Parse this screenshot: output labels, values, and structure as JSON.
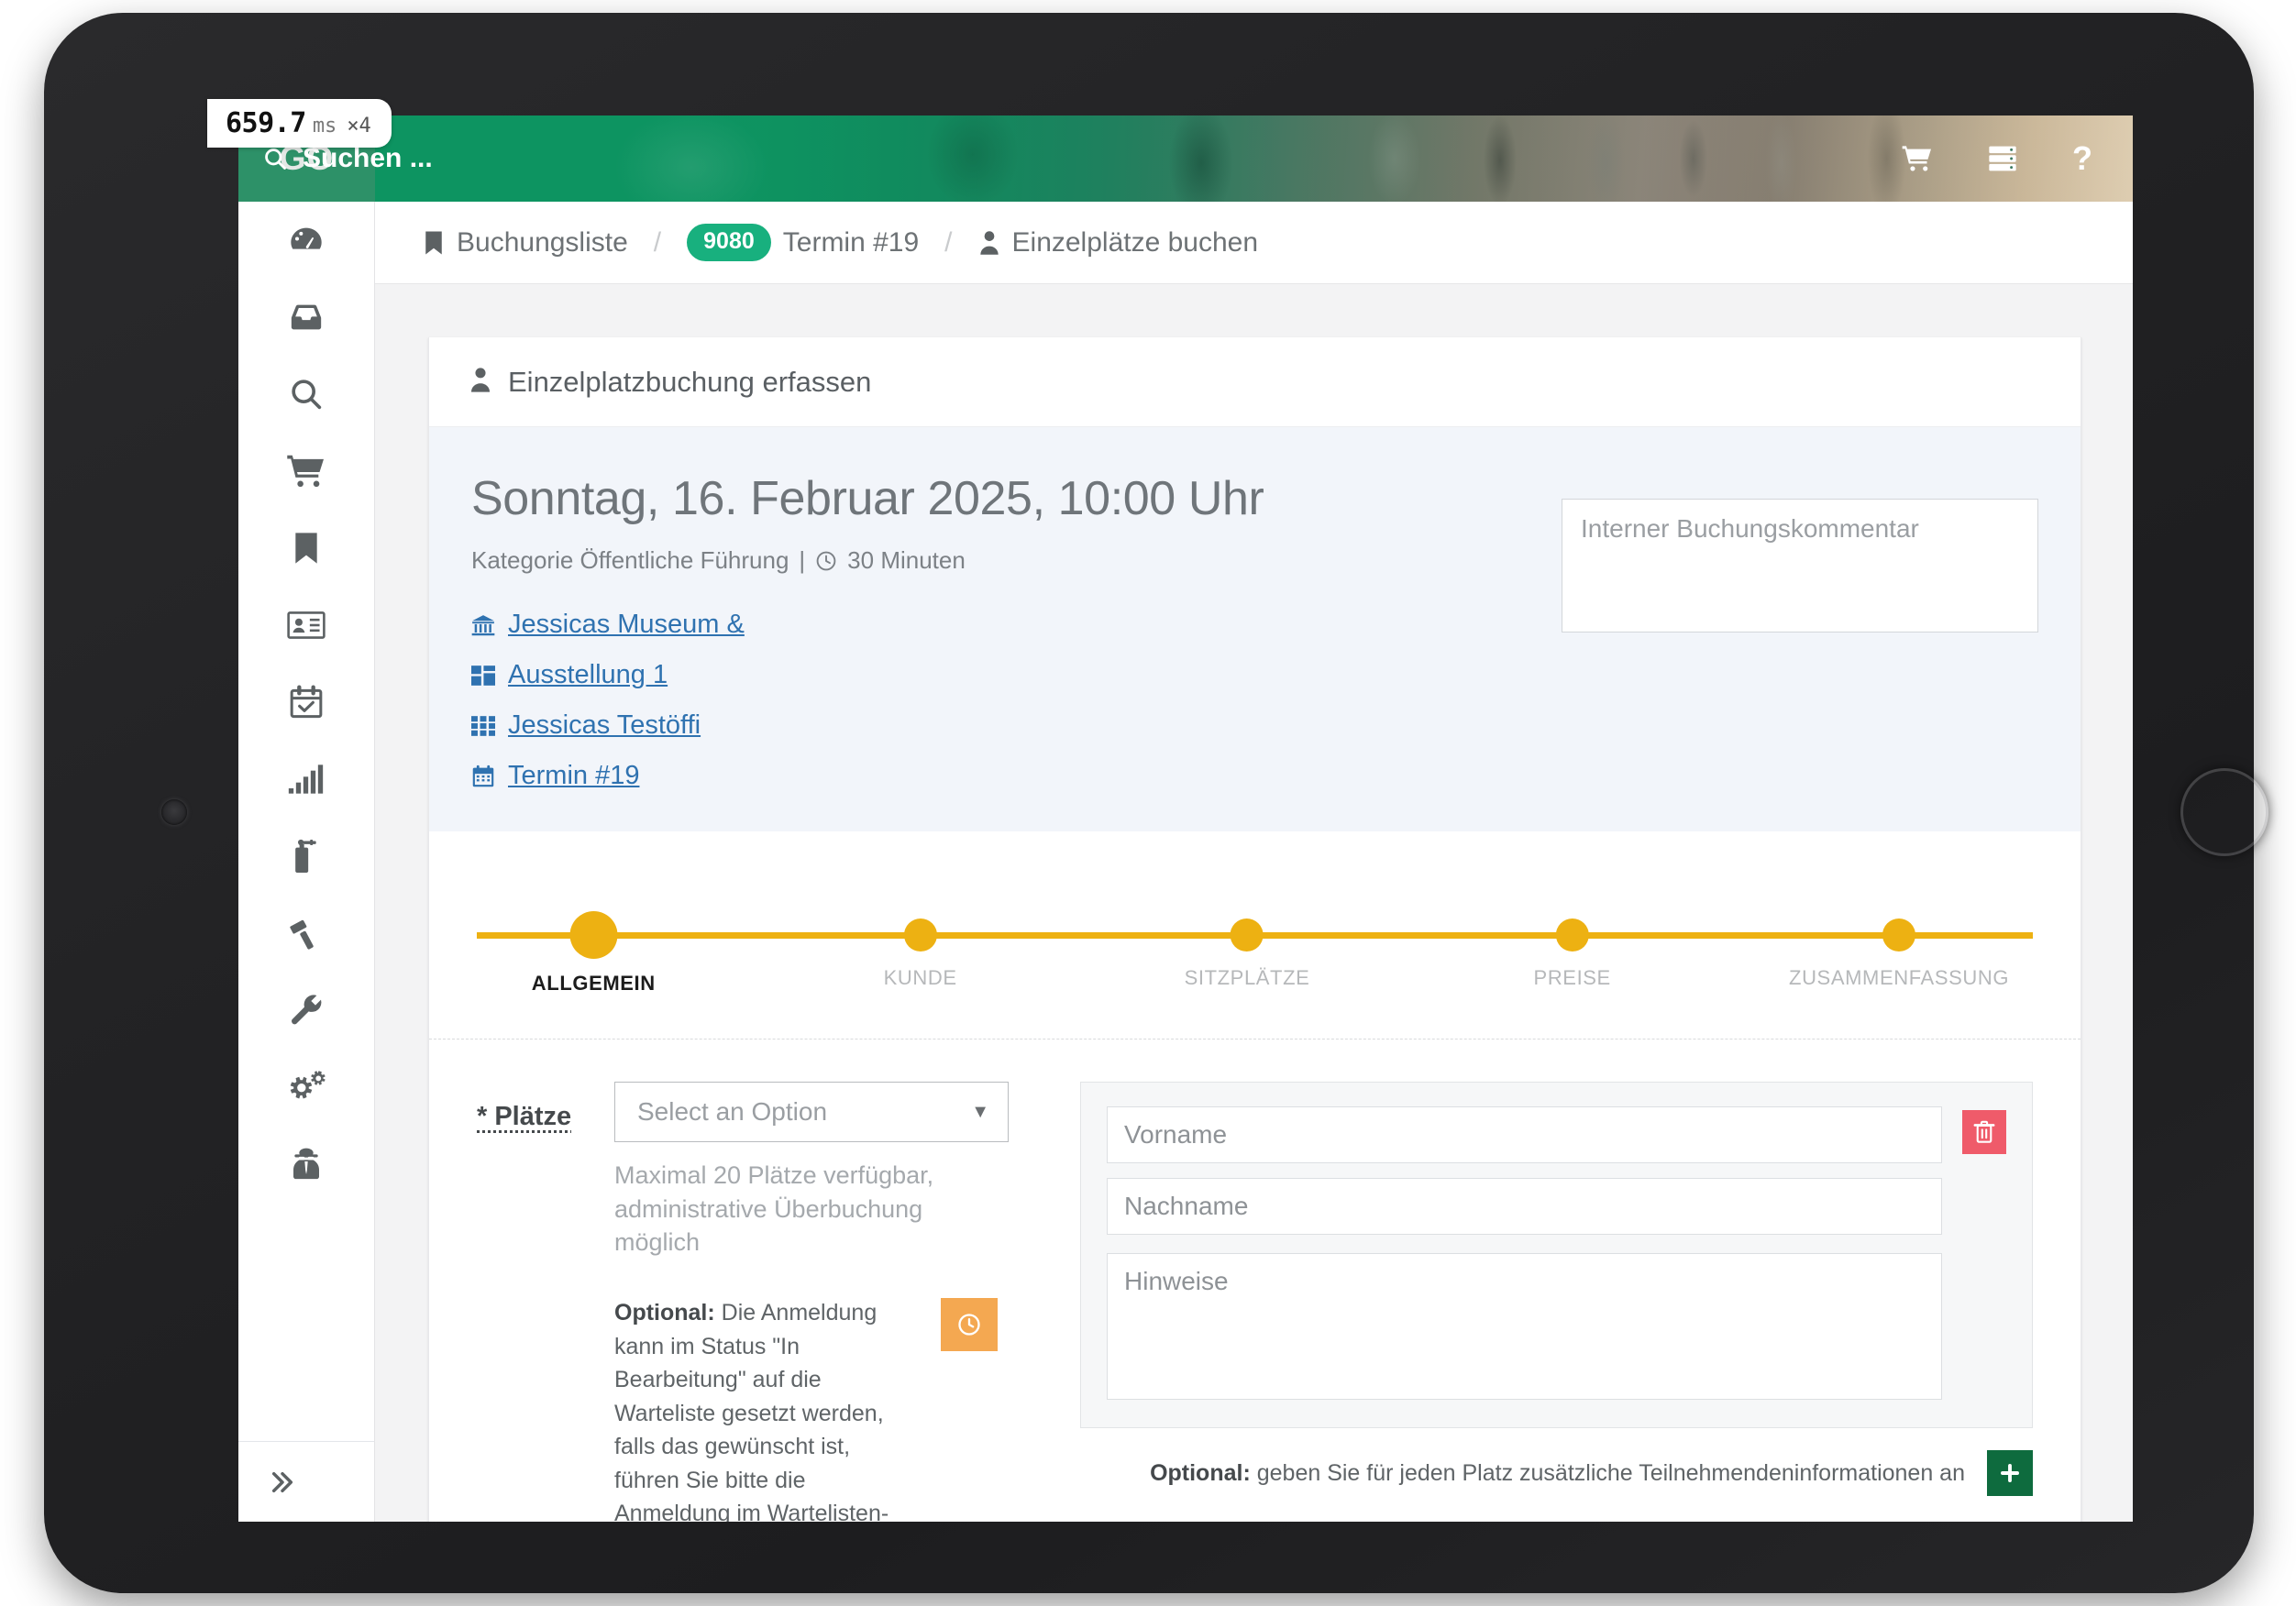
{
  "perf": {
    "value": "659.7",
    "unit": "ms",
    "multiplier": "×4"
  },
  "topbar": {
    "brand": "GO",
    "search_placeholder": "Suchen ...",
    "icons": {
      "search": "search-icon",
      "cart": "shopping-cart-icon",
      "server": "server-icon",
      "help": "?"
    }
  },
  "sidebar": {
    "items": [
      {
        "name": "dashboard",
        "icon": "tachometer-icon"
      },
      {
        "name": "inbox",
        "icon": "inbox-icon"
      },
      {
        "name": "search",
        "icon": "search-icon"
      },
      {
        "name": "shop",
        "icon": "shopping-cart-icon"
      },
      {
        "name": "bookings",
        "icon": "bookmark-icon"
      },
      {
        "name": "contacts",
        "icon": "id-card-icon"
      },
      {
        "name": "calendar",
        "icon": "calendar-check-icon"
      },
      {
        "name": "statistics",
        "icon": "signal-bars-icon"
      },
      {
        "name": "safety",
        "icon": "fire-extinguisher-icon"
      },
      {
        "name": "legal",
        "icon": "gavel-icon"
      },
      {
        "name": "tools",
        "icon": "wrench-icon"
      },
      {
        "name": "settings",
        "icon": "cogs-icon"
      },
      {
        "name": "privacy",
        "icon": "user-secret-icon"
      }
    ],
    "expand_icon": "chevron-double-right-icon"
  },
  "breadcrumb": {
    "items": [
      {
        "icon": "bookmark-icon",
        "label": "Buchungsliste",
        "badge": null
      },
      {
        "icon": null,
        "label": "Termin #19",
        "badge": "9080"
      },
      {
        "icon": "user-icon",
        "label": "Einzelplätze buchen",
        "badge": null
      }
    ],
    "separator": "/"
  },
  "card": {
    "header": {
      "icon": "user-icon",
      "title": "Einzelplatzbuchung erfassen"
    },
    "event": {
      "title": "Sonntag, 16. Februar 2025, 10:00 Uhr",
      "category_text": "Kategorie Öffentliche Führung",
      "meta_separator": "|",
      "duration_icon": "clock-icon",
      "duration": "30 Minuten",
      "links": [
        {
          "icon": "museum-icon",
          "label": "Jessicas Museum &"
        },
        {
          "icon": "grid-icon",
          "label": "Ausstellung 1"
        },
        {
          "icon": "table-cells-icon",
          "label": "Jessicas Testöffi"
        },
        {
          "icon": "calendar-icon",
          "label": "Termin #19"
        }
      ],
      "comment_placeholder": "Interner Buchungskommentar",
      "comment_value": ""
    },
    "stepper": {
      "steps": [
        {
          "label": "ALLGEMEIN",
          "active": true
        },
        {
          "label": "KUNDE",
          "active": false
        },
        {
          "label": "SITZPLÄTZE",
          "active": false
        },
        {
          "label": "PREISE",
          "active": false
        },
        {
          "label": "ZUSAMMENFASSUNG",
          "active": false
        }
      ],
      "accent_color": "#edb112"
    },
    "form": {
      "places_label": "* Plätze",
      "places_select_value": "Select an Option",
      "places_caret": "▼",
      "places_hint": "Maximal 20 Plätze verfügbar, administrative Überbuchung möglich",
      "optional_note_strong": "Optional:",
      "optional_note_text": " Die Anmeldung kann im Status \"In Bearbeitung\" auf die Warteliste gesetzt werden, falls das gewünscht ist, führen Sie bitte die Anmeldung im Wartelisten-Modus aus.",
      "waitlist_button_icon": "clock-icon",
      "waitlist_button_color": "#f4a851",
      "participant": {
        "vorname_placeholder": "Vorname",
        "vorname_value": "",
        "nachname_placeholder": "Nachname",
        "nachname_value": "",
        "hinweise_placeholder": "Hinweise",
        "hinweise_value": "",
        "delete_icon": "trash-icon",
        "delete_color": "#ef5b6a"
      },
      "add_row_strong": "Optional:",
      "add_row_text": " geben Sie für jeden Platz zusätzliche Teilnehmendeninformationen an",
      "add_icon": "plus-icon",
      "add_color": "#0e6b3e"
    }
  }
}
